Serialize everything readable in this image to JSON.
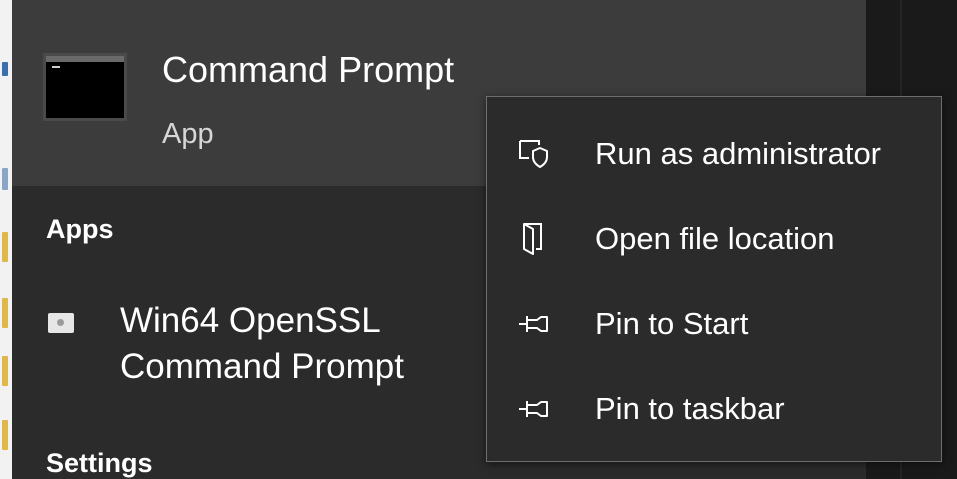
{
  "top_result": {
    "title": "Command Prompt",
    "subtitle": "App",
    "icon": "command-prompt-icon"
  },
  "sections": {
    "apps_header": "Apps",
    "settings_header": "Settings"
  },
  "apps": [
    {
      "label": "Win64 OpenSSL Command Prompt",
      "icon": "openssl-app-icon"
    }
  ],
  "context_menu": {
    "items": [
      {
        "label": "Run as administrator",
        "icon": "shield-icon"
      },
      {
        "label": "Open file location",
        "icon": "folder-open-icon"
      },
      {
        "label": "Pin to Start",
        "icon": "pin-icon"
      },
      {
        "label": "Pin to taskbar",
        "icon": "pin-icon"
      }
    ]
  },
  "colors": {
    "panel_bg": "#2b2b2b",
    "selected_bg": "#3c3c3c",
    "menu_border": "#6e6e6e",
    "text": "#ffffff"
  }
}
